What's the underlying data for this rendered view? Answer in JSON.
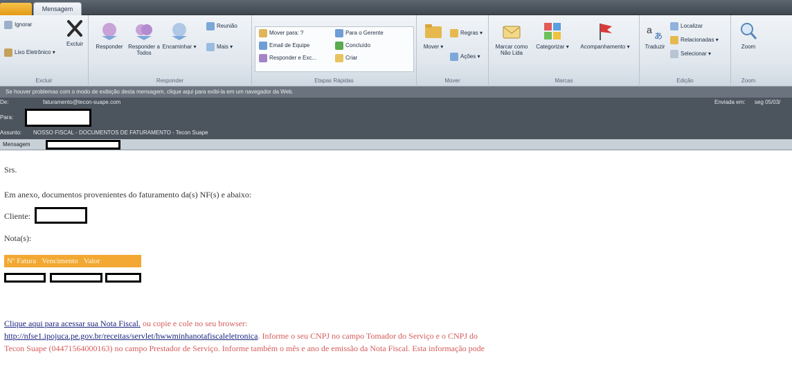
{
  "tabs": {
    "active": "Mensagem"
  },
  "ribbon": {
    "excluir": {
      "ignorar": "Ignorar",
      "lixo": "Lixo Eletrônico",
      "excluir": "Excluir",
      "label": "Excluir"
    },
    "responder": {
      "responder": "Responder",
      "responder_todos": "Responder a Todos",
      "encaminhar": "Encaminhar",
      "reuniao": "Reunião",
      "mais": "Mais",
      "label": "Responder"
    },
    "etapas": {
      "mover_para": "Mover para: ?",
      "email_equipe": "Email de Equipe",
      "responder_exc": "Responder e Exc...",
      "para_gerente": "Para o Gerente",
      "concluido": "Concluído",
      "criar": "Criar",
      "label": "Etapas Rápidas"
    },
    "mover": {
      "mover": "Mover",
      "regras": "Regras",
      "acoes": "Ações",
      "label": "Mover"
    },
    "marcas": {
      "marcar_nao_lida": "Marcar como Não Lida",
      "categorizar": "Categorizar",
      "acompanhamento": "Acompanhamento",
      "label": "Marcas"
    },
    "edicao": {
      "traduzir": "Traduzir",
      "localizar": "Localizar",
      "relacionadas": "Relacionadas",
      "selecionar": "Selecionar",
      "label": "Edição"
    },
    "zoom": {
      "zoom": "Zoom",
      "label": "Zoom"
    }
  },
  "infobar": "Se houver problemas com o modo de exibição desta mensagem, clique aqui para exibi-la em um navegador da Web.",
  "header": {
    "from_email": "faturamento@tecon-suape.com",
    "subject_label": "Assunto:",
    "subject": "NOSSO FISCAL - DOCUMENTOS DE FATURAMENTO - Tecon Suape",
    "sent_label": "Enviada em:",
    "sent_value": "seg 05/03/",
    "attachment_label": "Mensagem"
  },
  "body": {
    "greeting": "Srs.",
    "intro": "Em anexo, documentos provenientes do faturamento da(s) NF(s) e abaixo:",
    "cliente_label": "Cliente:",
    "notas_label": "Nota(s):",
    "table_headers": [
      "Nº Fatura",
      "Vencimento",
      "Valor"
    ],
    "link_text": "Clique aqui para acessar sua Nota Fiscal.",
    "link_suffix": " ou copie e cole no seu browser:",
    "url": "http://nfse1.ipojuca.pe.gov.br/receitas/servlet/hwwminhanotafiscaleletronica",
    "instr1": ". Informe o seu CNPJ no campo Tomador do Serviço e o CNPJ do",
    "instr2": "Tecon Suape (04471564000163) no campo Prestador de Serviço. Informe também o mês e ano de emissão da Nota Fiscal. Esta informação pode"
  },
  "colors": {
    "ribbon_bg": "#dfe6ed",
    "header_bg": "#4c545d",
    "table_orange": "#f2a832",
    "link": "#1a237e",
    "instruction_red": "#d65a5a"
  }
}
